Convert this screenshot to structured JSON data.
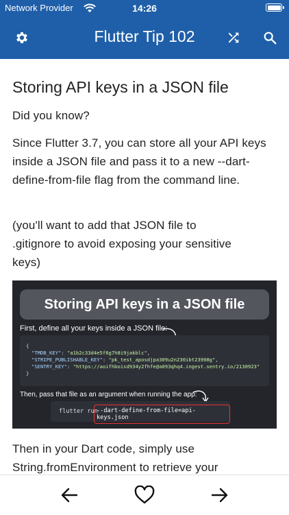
{
  "status_bar": {
    "carrier": "Network Provider",
    "time": "14:26",
    "battery_level": 1.0
  },
  "app_bar": {
    "title": "Flutter Tip 102",
    "settings_icon": "gear-icon",
    "shuffle_icon": "shuffle-icon",
    "search_icon": "search-icon"
  },
  "article": {
    "heading": "Storing API keys in a JSON file",
    "paragraphs": [
      "Did you know?",
      "Since Flutter 3.7, you can store all your API keys inside a JSON file and pass it to a new --dart-define-from-file flag from the command line.",
      "(you'll want to add that JSON file to .gitignore to avoid exposing your sensitive keys)",
      "Then in your Dart code, simply use String.fromEnvironment to retrieve your"
    ],
    "figure": {
      "title": "Storing API keys in a JSON file",
      "intro": "First, define all your keys inside a JSON file:",
      "json_open": "{",
      "json_lines": [
        {
          "key": "\"TMDB_KEY\"",
          "value": "\"a1b2c33d4e5f6g7h8i9jakblc\"",
          "tail": ","
        },
        {
          "key": "\"STRIPE_PUBLISHABLE_KEY\"",
          "value": "\"pk_test_aposdjpa309u2n230ibt23908g\"",
          "tail": ","
        },
        {
          "key": "\"SENTRY_KEY\"",
          "value": "\"https://aoifhboisd934y2fhfe@a093qhq4.ingest.sentry.io/2130923\"",
          "tail": ""
        }
      ],
      "json_close": "}",
      "then": "Then, pass that file as an argument when running the app:",
      "command": "flutter run",
      "flag": "--dart-define-from-file=api-keys.json"
    }
  },
  "bottom_nav": {
    "back_icon": "arrow-left-icon",
    "favorite_icon": "heart-icon",
    "forward_icon": "arrow-right-icon"
  },
  "colors": {
    "primary": "#1f5fa9",
    "figure_background": "#23252b",
    "highlight_border": "#ee3333"
  }
}
